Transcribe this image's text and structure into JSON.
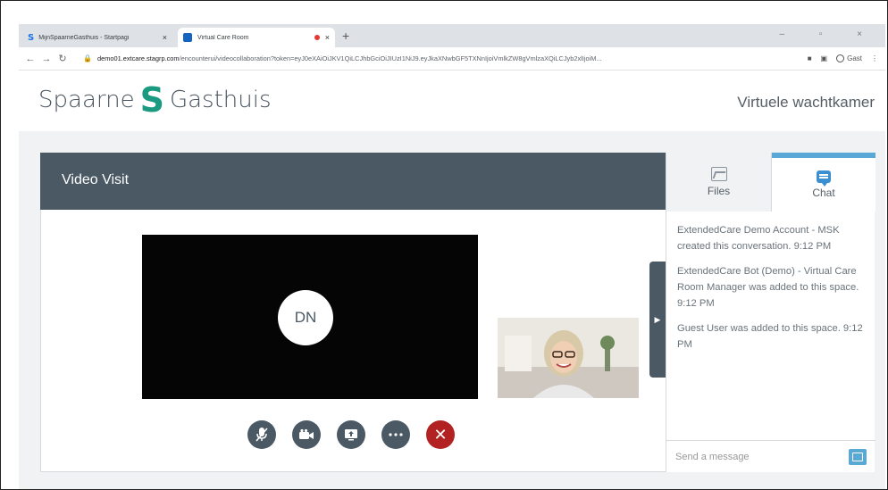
{
  "browser": {
    "tabs": [
      {
        "title": "MijnSpaarneGasthuis - Startpagi",
        "close": "×"
      },
      {
        "title": "Virtual Care Room",
        "close": "×"
      }
    ],
    "new_tab": "+",
    "window_controls": "– ▫ ×",
    "url_host": "demo01.extcare.stagrp.com",
    "url_path": "/encounterui/videocollaboration?token=eyJ0eXAiOiJKV1QiLCJhbGciOiJIUzI1NiJ9.eyJkaXNwbGF5TXNnIjoiVmlkZW8gVmlzaXQiLCJyb2xlIjoiM...",
    "profile_label": "Gast"
  },
  "site": {
    "logo_left": "Spaarne",
    "logo_mark": "S",
    "logo_right": "Gasthuis",
    "waiting_room": "Virtuele wachtkamer"
  },
  "video": {
    "title": "Video Visit",
    "remote_initials": "DN"
  },
  "controls": {
    "end_symbol": "✕"
  },
  "sidebar": {
    "files_label": "Files",
    "chat_label": "Chat",
    "messages": [
      {
        "text": "ExtendedCare Demo Account - MSK created this conversation. 9:12 PM"
      },
      {
        "text": "ExtendedCare Bot (Demo) - Virtual Care Room Manager was added to this space. 9:12 PM"
      },
      {
        "text": "Guest User was added to this space. 9:12 PM"
      }
    ],
    "composer_placeholder": "Send a message"
  }
}
